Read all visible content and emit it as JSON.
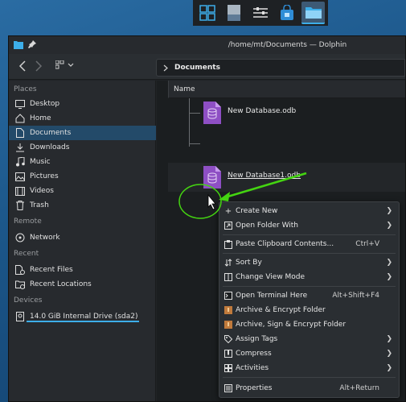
{
  "window": {
    "title": "/home/mt/Documents — Dolphin"
  },
  "toolbar": {
    "breadcrumb": "Documents"
  },
  "sidebar": {
    "places_header": "Places",
    "places": [
      "Desktop",
      "Home",
      "Documents",
      "Downloads",
      "Music",
      "Pictures",
      "Videos",
      "Trash"
    ],
    "remote_header": "Remote",
    "remote": [
      "Network"
    ],
    "recent_header": "Recent",
    "recent": [
      "Recent Files",
      "Recent Locations"
    ],
    "devices_header": "Devices",
    "devices": [
      "14.0 GiB Internal Drive (sda2)"
    ]
  },
  "main": {
    "column_name": "Name",
    "files": [
      "New Database.odb",
      "New Database1.odb"
    ]
  },
  "context_menu": {
    "items": [
      {
        "label": "Create New",
        "shortcut": "",
        "submenu": true
      },
      {
        "label": "Open Folder With",
        "shortcut": "",
        "submenu": true
      },
      {
        "label": "Paste Clipboard Contents...",
        "shortcut": "Ctrl+V",
        "submenu": false
      },
      {
        "label": "Sort By",
        "shortcut": "",
        "submenu": true
      },
      {
        "label": "Change View Mode",
        "shortcut": "",
        "submenu": true
      },
      {
        "label": "Open Terminal Here",
        "shortcut": "Alt+Shift+F4",
        "submenu": false
      },
      {
        "label": "Archive & Encrypt Folder",
        "shortcut": "",
        "submenu": false
      },
      {
        "label": "Archive, Sign & Encrypt Folder",
        "shortcut": "",
        "submenu": false
      },
      {
        "label": "Assign Tags",
        "shortcut": "",
        "submenu": true
      },
      {
        "label": "Compress",
        "shortcut": "",
        "submenu": true
      },
      {
        "label": "Activities",
        "shortcut": "",
        "submenu": true
      },
      {
        "label": "Properties",
        "shortcut": "Alt+Return",
        "submenu": false
      }
    ]
  },
  "colors": {
    "accent": "#3daee9",
    "annotation": "#44d411",
    "selection": "#234a69",
    "db_icon": "#8e4fc4"
  }
}
